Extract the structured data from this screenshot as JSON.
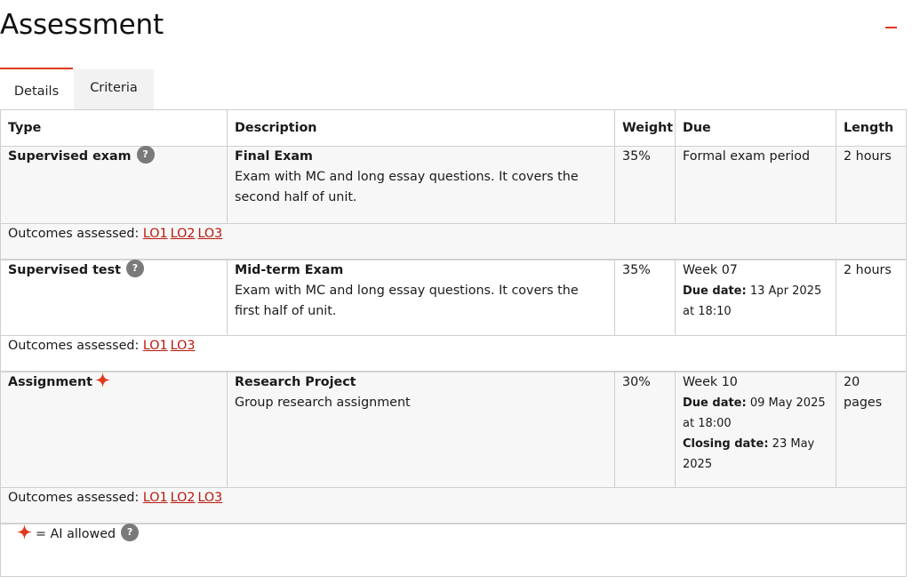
{
  "header": {
    "title": "Assessment"
  },
  "tabs": [
    {
      "label": "Details"
    },
    {
      "label": "Criteria"
    }
  ],
  "table": {
    "columns": [
      "Type",
      "Description",
      "Weight",
      "Due",
      "Length"
    ],
    "rows": [
      {
        "type": "Supervised exam",
        "title": "Final Exam",
        "description": "Exam with MC and long essay questions. It covers the second half of unit.",
        "weight": "35%",
        "due": "Formal exam period",
        "length": "2 hours",
        "outcomes_label": "Outcomes assessed:",
        "outcomes": [
          "LO1",
          "LO2",
          "LO3"
        ]
      },
      {
        "type": "Supervised test",
        "title": "Mid-term Exam",
        "description": "Exam with MC and long essay questions. It covers the first half of unit.",
        "weight": "35%",
        "due": "Week 07",
        "due_date_label": "Due date:",
        "due_date": "13 Apr 2025 at 18:10",
        "length": "2 hours",
        "outcomes_label": "Outcomes assessed:",
        "outcomes": [
          "LO1",
          "LO3"
        ]
      },
      {
        "type": "Assignment",
        "title": "Research Project",
        "description": "Group research assignment",
        "weight": "30%",
        "due": "Week 10",
        "due_date_label": "Due date:",
        "due_date": "09 May 2025 at 18:00",
        "closing_date_label": "Closing date:",
        "closing_date": "23 May 2025",
        "length": "20 pages",
        "outcomes_label": "Outcomes assessed:",
        "outcomes": [
          "LO1",
          "LO2",
          "LO3"
        ]
      }
    ]
  },
  "legend": {
    "text": "= AI allowed"
  },
  "icons": {
    "help": "?",
    "help_icon": "question-circle-icon",
    "ai_icon": "sparkle-icon",
    "collapse_icon": "minus-icon"
  },
  "colors": {
    "accent": "#e03a1e",
    "link": "#b8180c",
    "row_shade": "#f7f7f7",
    "help_badge": "#7a7a7a"
  }
}
